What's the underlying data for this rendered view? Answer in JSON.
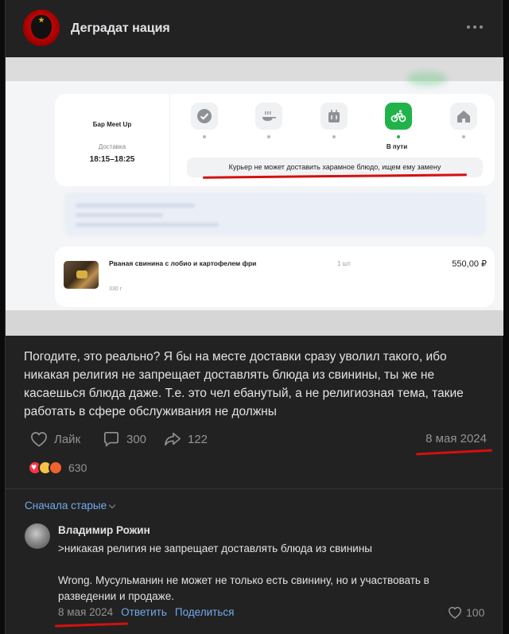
{
  "post": {
    "group_name": "Деградат нация",
    "more_icon": "more-horizontal-icon",
    "image": {
      "order": {
        "bar_name": "Бар Meet Up",
        "delivery_label": "Доставка",
        "delivery_time": "18:15–18:25"
      },
      "steps": [
        {
          "icon": "check-icon",
          "active": false
        },
        {
          "icon": "cooking-pan-icon",
          "active": false
        },
        {
          "icon": "packing-icon",
          "active": false
        },
        {
          "icon": "bicycle-icon",
          "active": true
        },
        {
          "icon": "home-icon",
          "active": false
        }
      ],
      "active_step_label": "В пути",
      "status_message": "Курьер не может доставить харамное блюдо, ищем ему замену",
      "item": {
        "name": "Рваная свинина с лобио и картофелем фри",
        "weight": "330 г",
        "qty": "1 шт",
        "price": "550,00 ₽"
      }
    },
    "text": "Погодите, это реально? Я бы на месте доставки сразу уволил такого, ибо никакая религия не запрещает доставлять блюда из свинины, ты же не касаешься блюда даже. Т.е. это чел ебанутый, а не религиозная тема, такие работать в сфере обслуживания не должны",
    "actions": {
      "like_label": "Лайк",
      "comments_count": "300",
      "shares_count": "122"
    },
    "date": "8 мая 2024",
    "reactions": {
      "emojis": [
        "heart",
        "laughing",
        "angry"
      ],
      "count": "630"
    }
  },
  "comments": {
    "sort_label": "Сначала старые",
    "items": [
      {
        "author": "Владимир Рожин",
        "lines": [
          ">никакая религия не запрещает доставлять блюда из свинины",
          "",
          "Wrong. Мусульманин не может не только есть свинину, но и участвовать в разведении и продаже."
        ],
        "date": "8 мая 2024",
        "reply_label": "Ответить",
        "share_label": "Поделиться",
        "likes": "100"
      }
    ]
  },
  "colors": {
    "background": "#222222",
    "text": "#e1e3e6",
    "secondary_text": "#939393",
    "link": "#71aaeb",
    "accent_green": "#21b34a",
    "annotation_red": "#d41010"
  }
}
